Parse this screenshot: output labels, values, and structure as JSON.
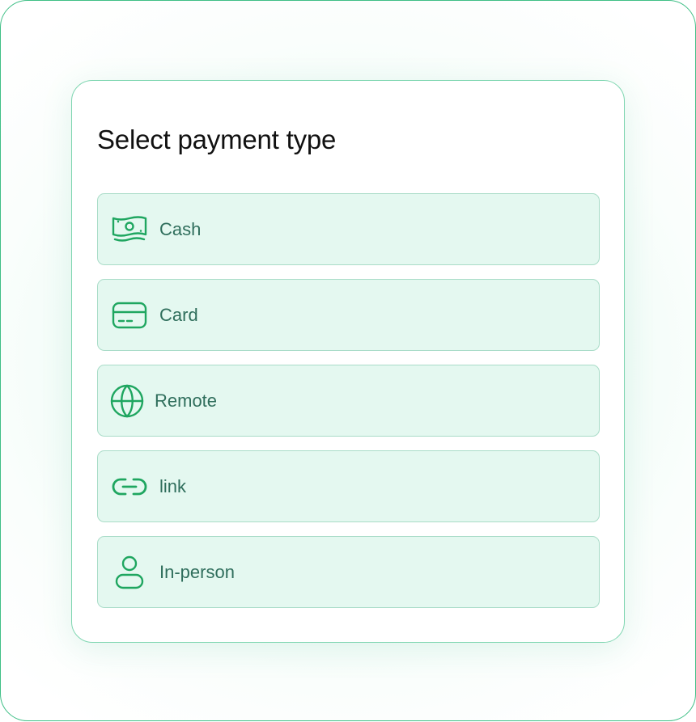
{
  "panel": {
    "title": "Select payment type"
  },
  "options": [
    {
      "label": "Cash",
      "icon": "cash-icon"
    },
    {
      "label": "Card",
      "icon": "card-icon"
    },
    {
      "label": "Remote",
      "icon": "globe-icon"
    },
    {
      "label": "link",
      "icon": "link-icon"
    },
    {
      "label": "In-person",
      "icon": "person-icon"
    }
  ],
  "colors": {
    "accent": "#1fa660",
    "option_bg": "#e4f8f0",
    "option_border": "#a9dcc8",
    "label_text": "#2f6e5c",
    "title_text": "#111111"
  }
}
